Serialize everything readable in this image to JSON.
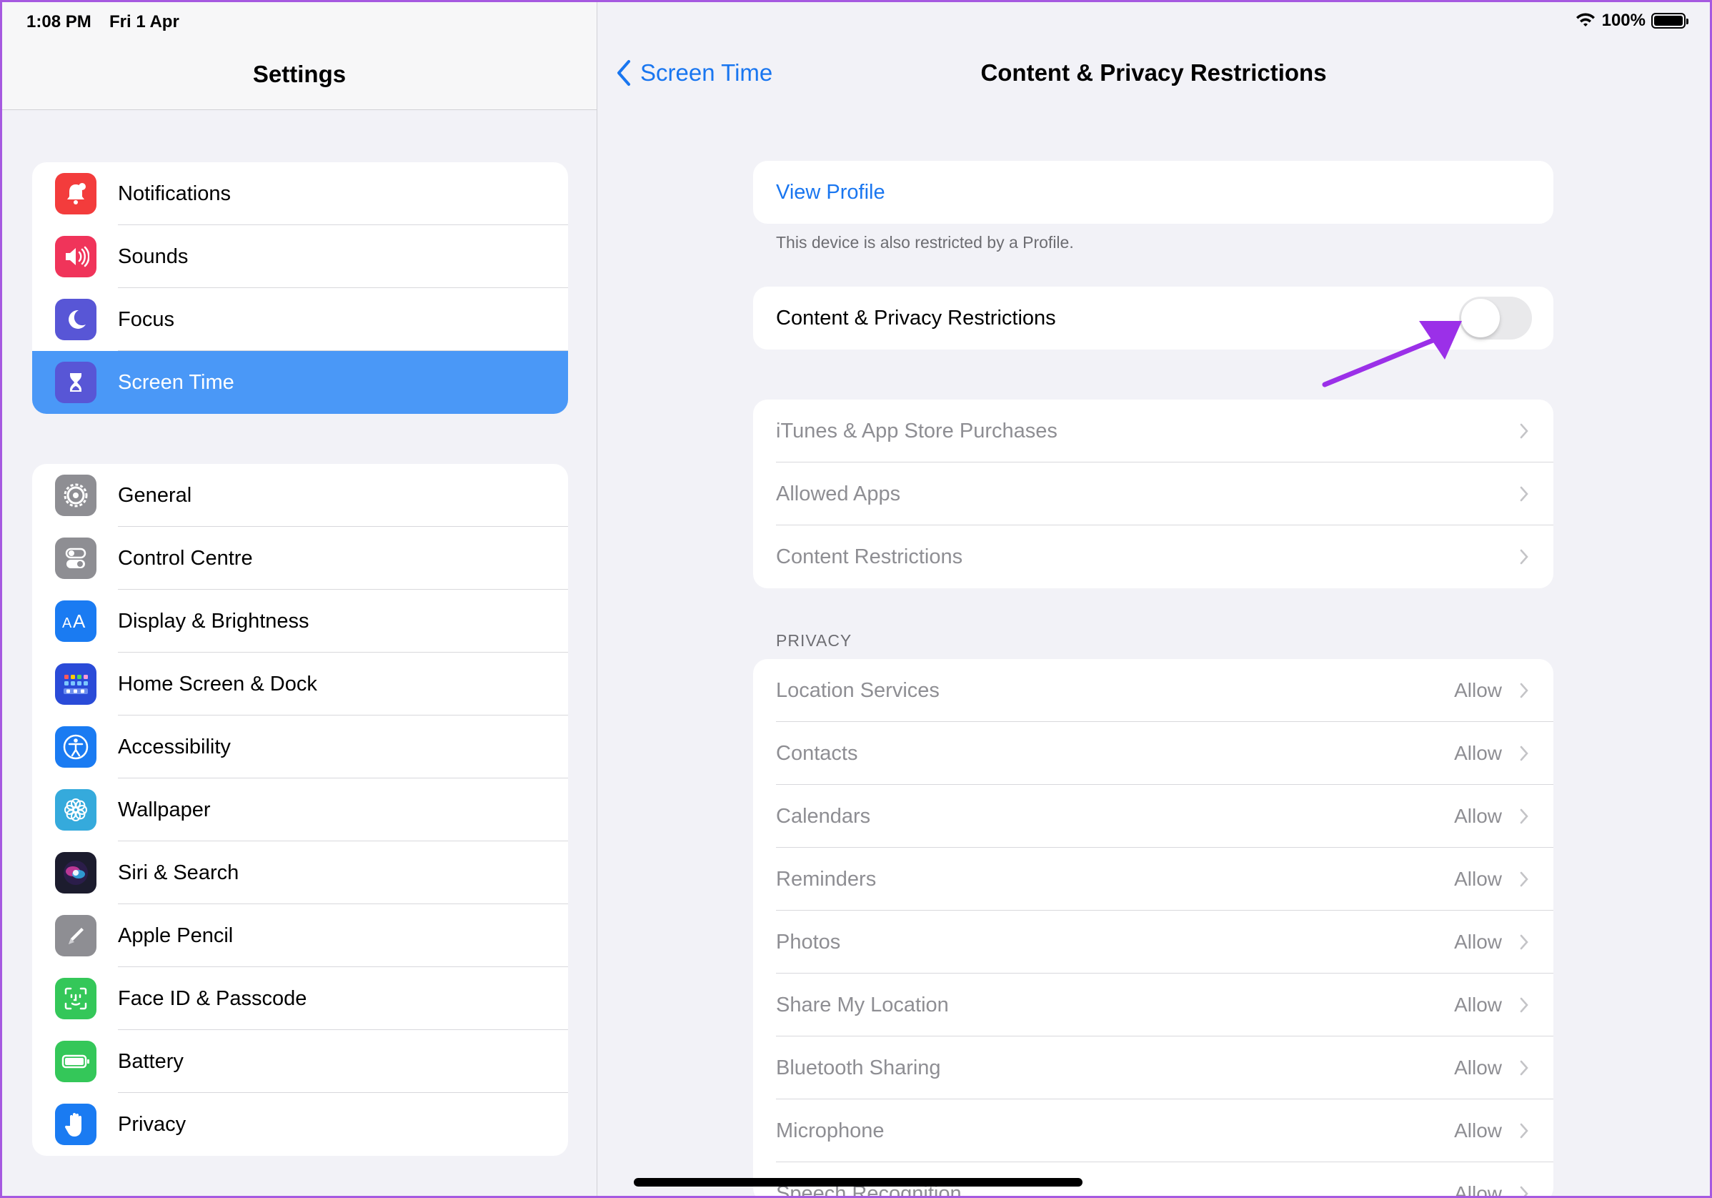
{
  "status": {
    "time": "1:08 PM",
    "date": "Fri 1 Apr",
    "battery": "100%"
  },
  "sidebar": {
    "title": "Settings",
    "group1": [
      {
        "label": "Notifications",
        "icon": "bell-icon",
        "color": "#f33c3c"
      },
      {
        "label": "Sounds",
        "icon": "speaker-icon",
        "color": "#f0345a"
      },
      {
        "label": "Focus",
        "icon": "moon-icon",
        "color": "#5856d6"
      },
      {
        "label": "Screen Time",
        "icon": "hourglass-icon",
        "color": "#5856d6",
        "selected": true
      }
    ],
    "group2": [
      {
        "label": "General",
        "icon": "gear-icon",
        "color": "#8e8e93"
      },
      {
        "label": "Control Centre",
        "icon": "toggles-icon",
        "color": "#8e8e93"
      },
      {
        "label": "Display & Brightness",
        "icon": "text-size-icon",
        "color": "#1a7bf2"
      },
      {
        "label": "Home Screen & Dock",
        "icon": "grid-icon",
        "color": "#2a4bd8"
      },
      {
        "label": "Accessibility",
        "icon": "accessibility-icon",
        "color": "#1a7bf2"
      },
      {
        "label": "Wallpaper",
        "icon": "flower-icon",
        "color": "#35aadc"
      },
      {
        "label": "Siri & Search",
        "icon": "siri-icon",
        "color": "#1c1c2e"
      },
      {
        "label": "Apple Pencil",
        "icon": "pencil-icon",
        "color": "#8e8e93"
      },
      {
        "label": "Face ID & Passcode",
        "icon": "face-id-icon",
        "color": "#34c759"
      },
      {
        "label": "Battery",
        "icon": "battery-icon",
        "color": "#34c759"
      },
      {
        "label": "Privacy",
        "icon": "hand-icon",
        "color": "#1a7bf2"
      }
    ]
  },
  "detail": {
    "back_label": "Screen Time",
    "title": "Content & Privacy Restrictions",
    "view_profile": "View Profile",
    "profile_note": "This device is also restricted by a Profile.",
    "restrictions_toggle_label": "Content & Privacy Restrictions",
    "restrictions_enabled": false,
    "store_rows": [
      "iTunes & App Store Purchases",
      "Allowed Apps",
      "Content Restrictions"
    ],
    "privacy_header": "PRIVACY",
    "privacy_rows": [
      {
        "label": "Location Services",
        "value": "Allow"
      },
      {
        "label": "Contacts",
        "value": "Allow"
      },
      {
        "label": "Calendars",
        "value": "Allow"
      },
      {
        "label": "Reminders",
        "value": "Allow"
      },
      {
        "label": "Photos",
        "value": "Allow"
      },
      {
        "label": "Share My Location",
        "value": "Allow"
      },
      {
        "label": "Bluetooth Sharing",
        "value": "Allow"
      },
      {
        "label": "Microphone",
        "value": "Allow"
      },
      {
        "label": "Speech Recognition",
        "value": "Allow"
      }
    ]
  },
  "annotation_color": "#9b30e8"
}
